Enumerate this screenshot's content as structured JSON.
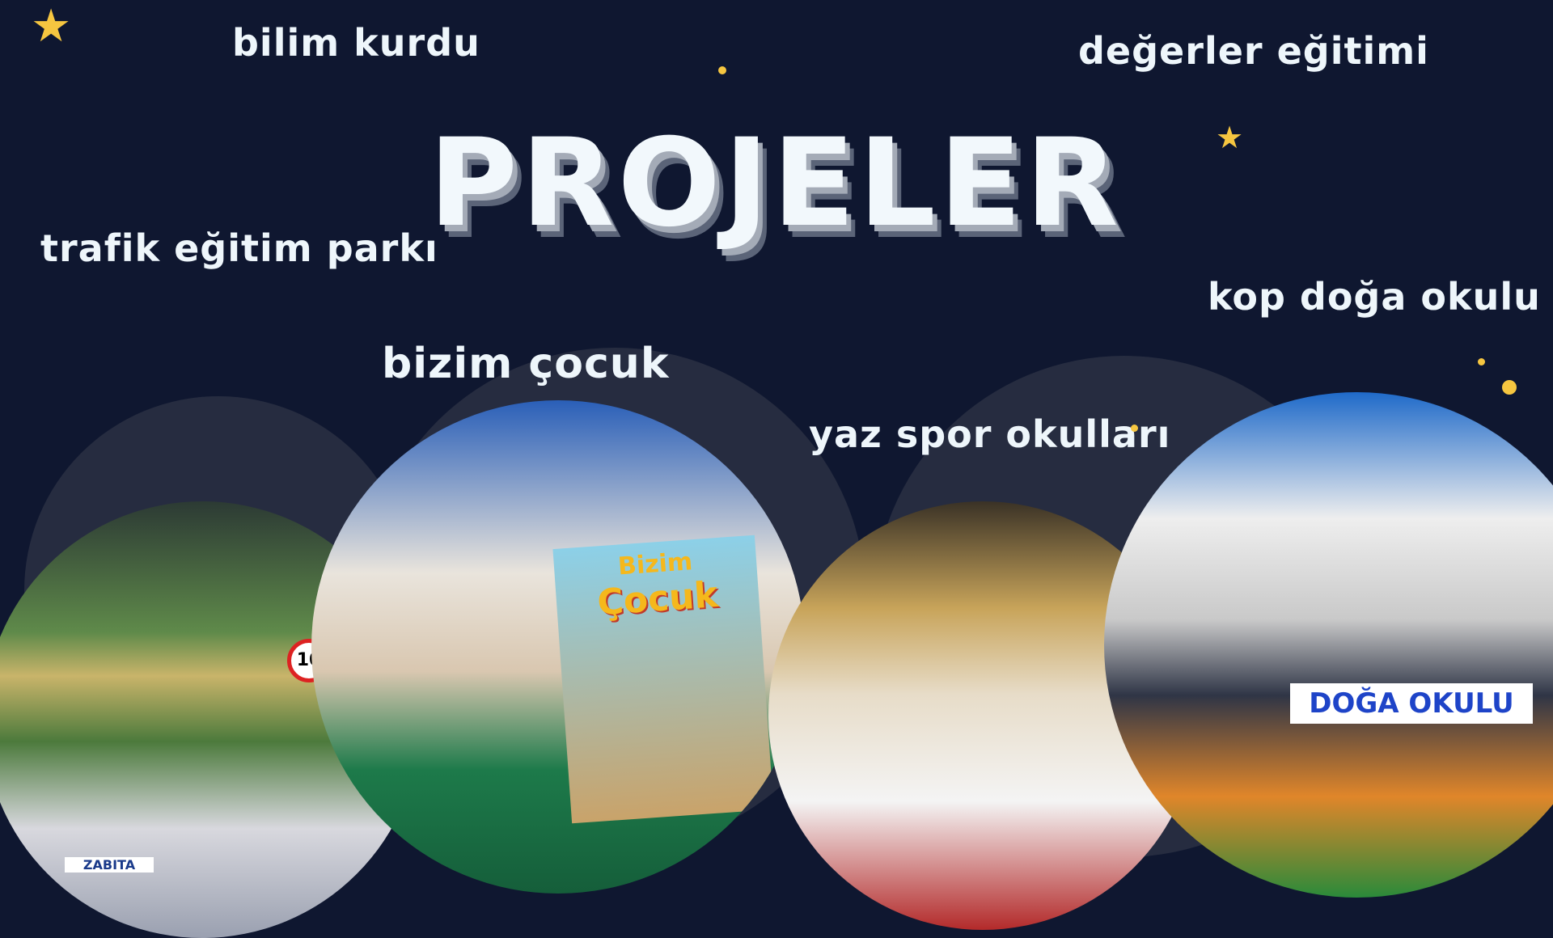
{
  "title": "PROJELER",
  "projects": [
    {
      "label": "bilim kurdu"
    },
    {
      "label": "değerler eğitimi"
    },
    {
      "label": "trafik eğitim parkı"
    },
    {
      "label": "kop doğa okulu"
    },
    {
      "label": "bizim çocuk"
    },
    {
      "label": "yaz spor okulları"
    }
  ],
  "photos": {
    "trafik": {
      "sign": "10",
      "vehicle": "ZABITA"
    },
    "bizim_cocuk": {
      "magazine_title_1": "Bizim",
      "magazine_title_2": "Çocuk"
    },
    "kop": {
      "banner": "DOĞA OKULU"
    }
  },
  "colors": {
    "background": "#0f1730",
    "arc": "#262c40",
    "star": "#f6c640",
    "text": "#eef6fb"
  }
}
